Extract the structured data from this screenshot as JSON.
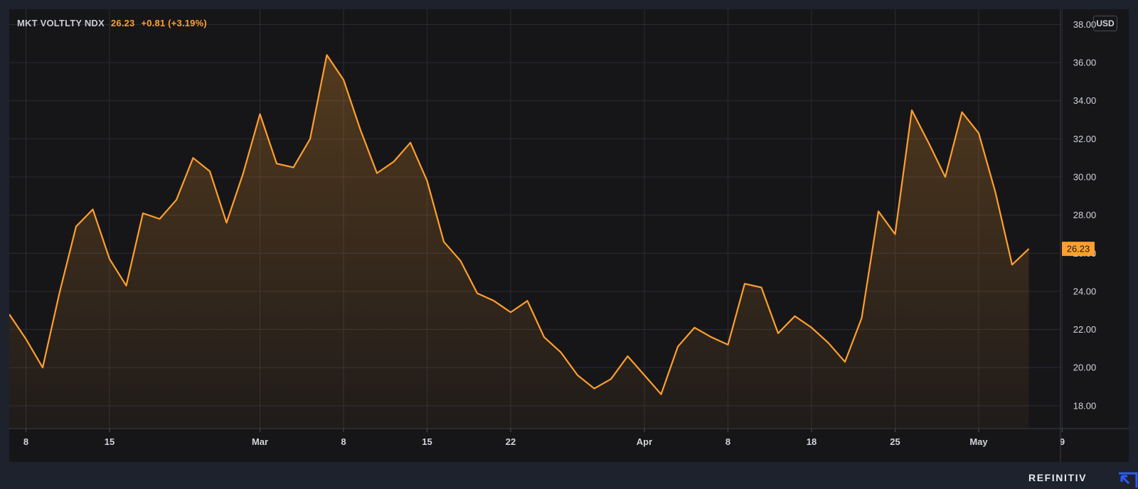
{
  "legend": {
    "symbol": "MKT VOLTLTY NDX",
    "value": "26.23",
    "change": "+0.81 (+3.19%)"
  },
  "currency": "USD",
  "price_label": "26.23",
  "brand": "REFINITIV",
  "colors": {
    "background": "#1e222d",
    "panel": "#161619",
    "grid": "#2a2b31",
    "line": "#ff9f2d",
    "axis_text": "#d1d4dc"
  },
  "chart_data": {
    "type": "area",
    "title": "MKT VOLTLTY NDX",
    "xlabel": "",
    "ylabel": "USD",
    "ylim": [
      16.8,
      38.8
    ],
    "yticks": [
      "18.00",
      "20.00",
      "22.00",
      "24.00",
      "26.00",
      "28.00",
      "30.00",
      "32.00",
      "34.00",
      "36.00",
      "38.00"
    ],
    "xticks": [
      {
        "label": "8",
        "index": 1
      },
      {
        "label": "15",
        "index": 6
      },
      {
        "label": "Mar",
        "index": 15
      },
      {
        "label": "8",
        "index": 20
      },
      {
        "label": "15",
        "index": 25
      },
      {
        "label": "22",
        "index": 30
      },
      {
        "label": "Apr",
        "index": 38
      },
      {
        "label": "8",
        "index": 43
      },
      {
        "label": "18",
        "index": 48
      },
      {
        "label": "25",
        "index": 53
      },
      {
        "label": "May",
        "index": 58
      },
      {
        "label": "9",
        "index": 63
      }
    ],
    "grid": true,
    "series": [
      {
        "values": [
          22.8,
          21.5,
          20.0,
          23.9,
          27.4,
          28.3,
          25.7,
          24.3,
          28.1,
          27.8,
          28.8,
          31.0,
          30.3,
          27.6,
          30.2,
          33.3,
          30.7,
          30.5,
          32.0,
          36.4,
          35.1,
          32.5,
          30.2,
          30.8,
          31.8,
          29.8,
          26.6,
          25.6,
          23.9,
          23.5,
          22.9,
          23.5,
          21.6,
          20.8,
          19.6,
          18.9,
          19.4,
          20.6,
          19.6,
          18.6,
          21.1,
          22.1,
          21.6,
          21.2,
          24.4,
          24.2,
          21.8,
          22.7,
          22.1,
          21.3,
          20.3,
          22.6,
          28.2,
          27.0,
          33.5,
          31.8,
          30.0,
          33.4,
          32.3,
          29.2,
          25.4,
          26.23
        ]
      }
    ]
  }
}
